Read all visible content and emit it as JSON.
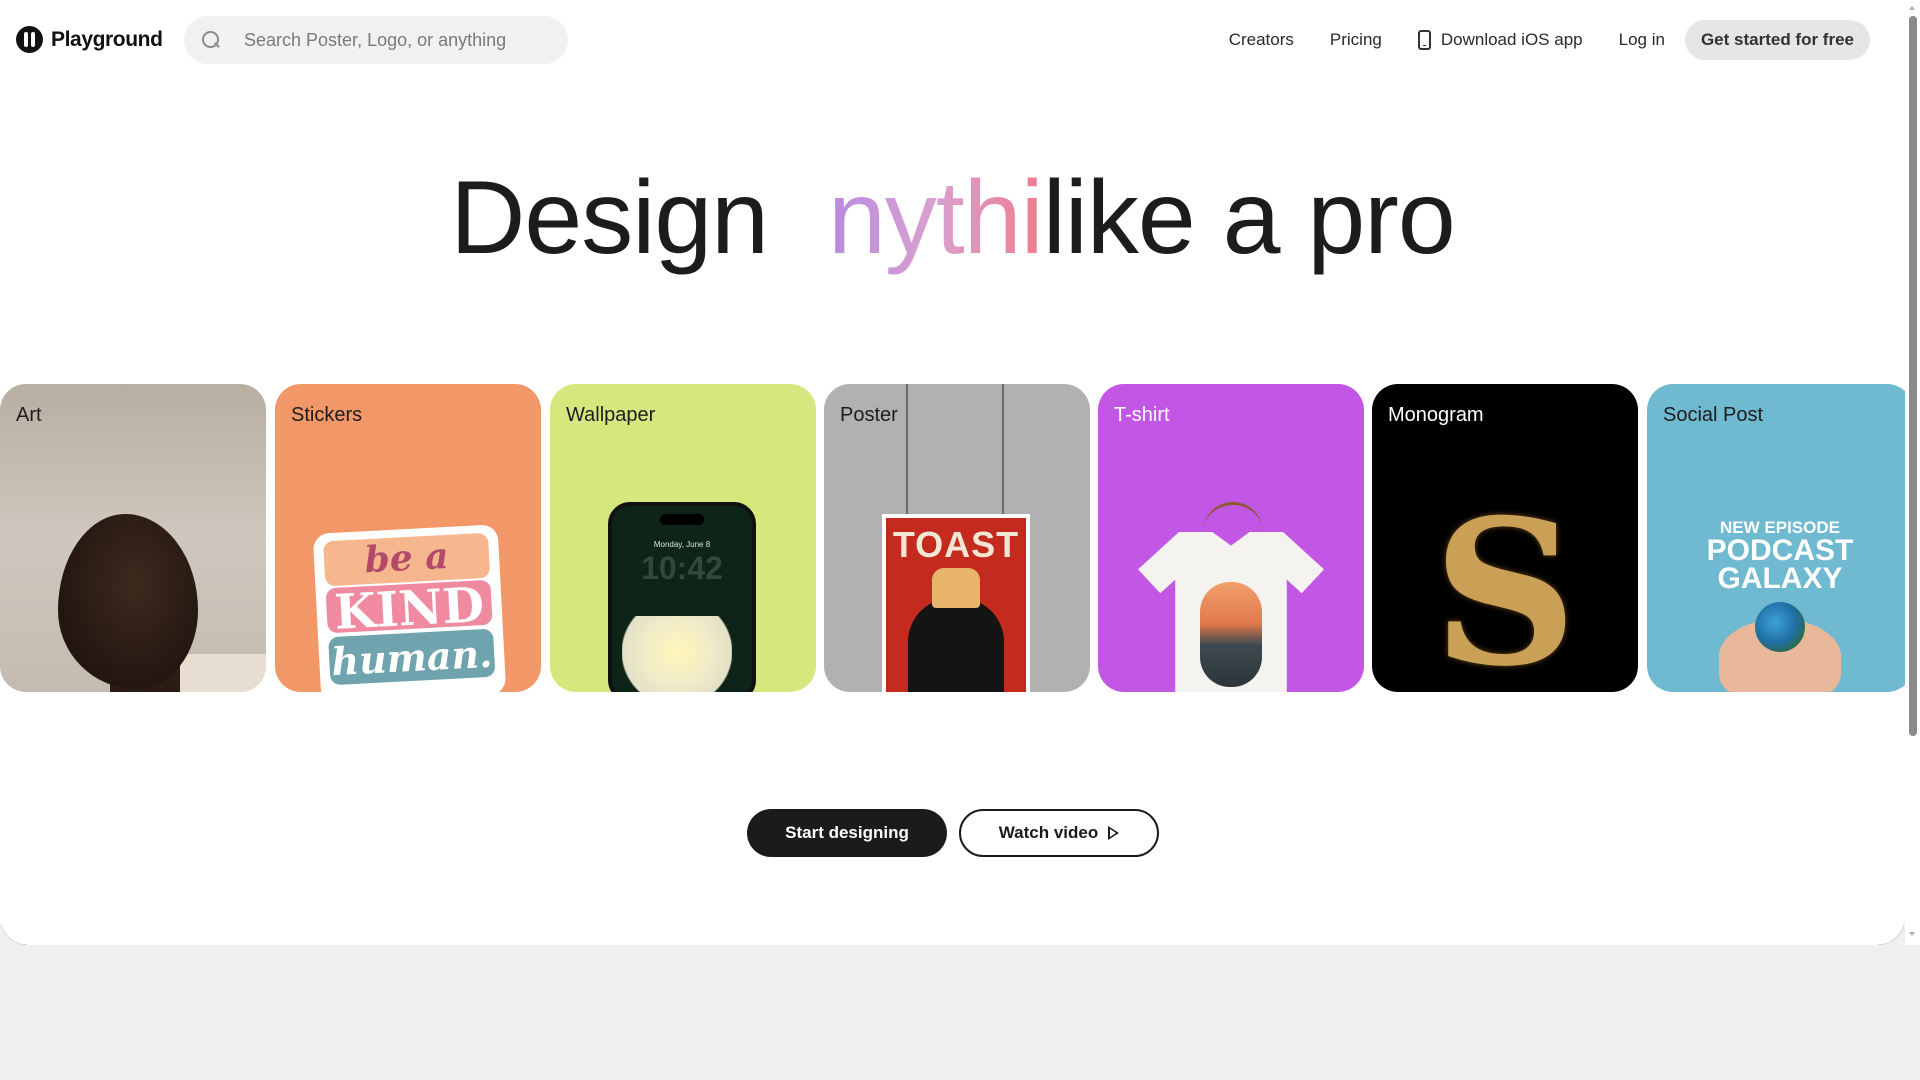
{
  "header": {
    "brand": "Playground",
    "search_placeholder": "Search Poster, Logo, or anything",
    "nav": {
      "creators": "Creators",
      "pricing": "Pricing",
      "download": "Download iOS app",
      "login": "Log in",
      "cta": "Get started for free"
    }
  },
  "hero": {
    "prefix": "Design",
    "animated_word": "nythi",
    "suffix": "like a pro"
  },
  "cards": [
    {
      "label": "Art"
    },
    {
      "label": "Stickers",
      "art_lines": [
        "be a",
        "KIND",
        "human."
      ]
    },
    {
      "label": "Wallpaper",
      "phone_date": "Monday, June 8",
      "phone_time": "10:42"
    },
    {
      "label": "Poster",
      "poster_title": "TOAST"
    },
    {
      "label": "T-shirt"
    },
    {
      "label": "Monogram",
      "letter": "S"
    },
    {
      "label": "Social Post",
      "art_lines": [
        "NEW EPISODE",
        "PODCAST",
        "GALAXY"
      ]
    }
  ],
  "actions": {
    "start": "Start designing",
    "watch": "Watch video"
  },
  "colors": {
    "art": "#c4bbb0",
    "stickers": "#f29767",
    "wallpaper": "#d4e87e",
    "poster": "#b1b1b1",
    "tshirt": "#c257e6",
    "monogram": "#000000",
    "social": "#6fbad0",
    "footer_bg": "#f0efed"
  }
}
